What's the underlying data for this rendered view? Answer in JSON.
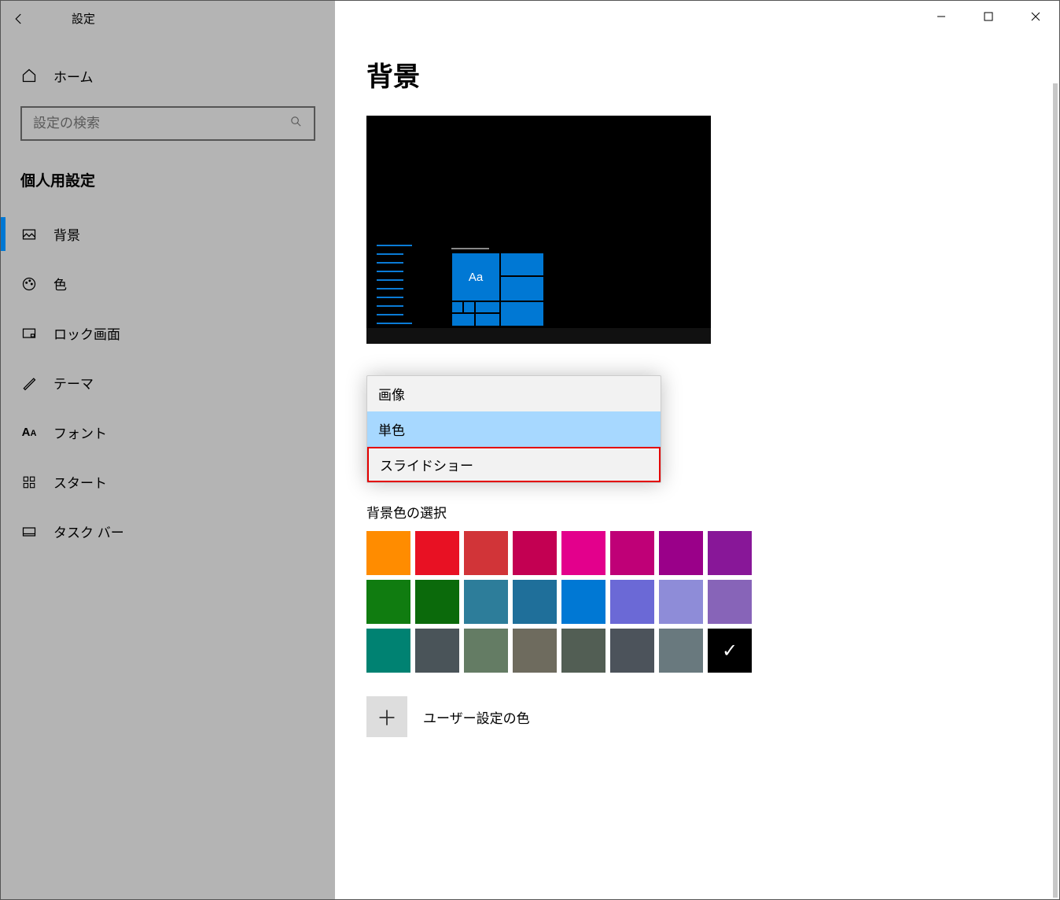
{
  "titlebar": {
    "title": "設定"
  },
  "sidebar": {
    "home": "ホーム",
    "search_placeholder": "設定の検索",
    "section": "個人用設定",
    "items": [
      {
        "icon": "picture-icon",
        "label": "背景",
        "active": true
      },
      {
        "icon": "palette-icon",
        "label": "色",
        "active": false
      },
      {
        "icon": "lock-icon",
        "label": "ロック画面",
        "active": false
      },
      {
        "icon": "brush-icon",
        "label": "テーマ",
        "active": false
      },
      {
        "icon": "font-icon",
        "label": "フォント",
        "active": false
      },
      {
        "icon": "start-icon",
        "label": "スタート",
        "active": false
      },
      {
        "icon": "taskbar-icon",
        "label": "タスク バー",
        "active": false
      }
    ]
  },
  "main": {
    "heading": "背景",
    "preview_sample": "Aa",
    "dropdown": {
      "options": [
        {
          "label": "画像",
          "selected": false,
          "highlight": false
        },
        {
          "label": "単色",
          "selected": true,
          "highlight": false
        },
        {
          "label": "スライドショー",
          "selected": false,
          "highlight": true
        }
      ]
    },
    "color_section_label": "背景色の選択",
    "color_rows": [
      [
        "#ff8c00",
        "#e81123",
        "#d13438",
        "#c30052",
        "#e3008c",
        "#bf0077",
        "#9a0089",
        "#881798"
      ],
      [
        "#107c10",
        "#0b6a0b",
        "#2d7d9a",
        "#1f6f9a",
        "#0078d4",
        "#6b69d6",
        "#8e8cd8",
        "#8764b8"
      ],
      [
        "#008272",
        "#4a5459",
        "#647c64",
        "#6e6b5e",
        "#525e54",
        "#4c535b",
        "#69797e",
        "#000000"
      ]
    ],
    "selected_color": "#000000",
    "custom_color_label": "ユーザー設定の色"
  }
}
